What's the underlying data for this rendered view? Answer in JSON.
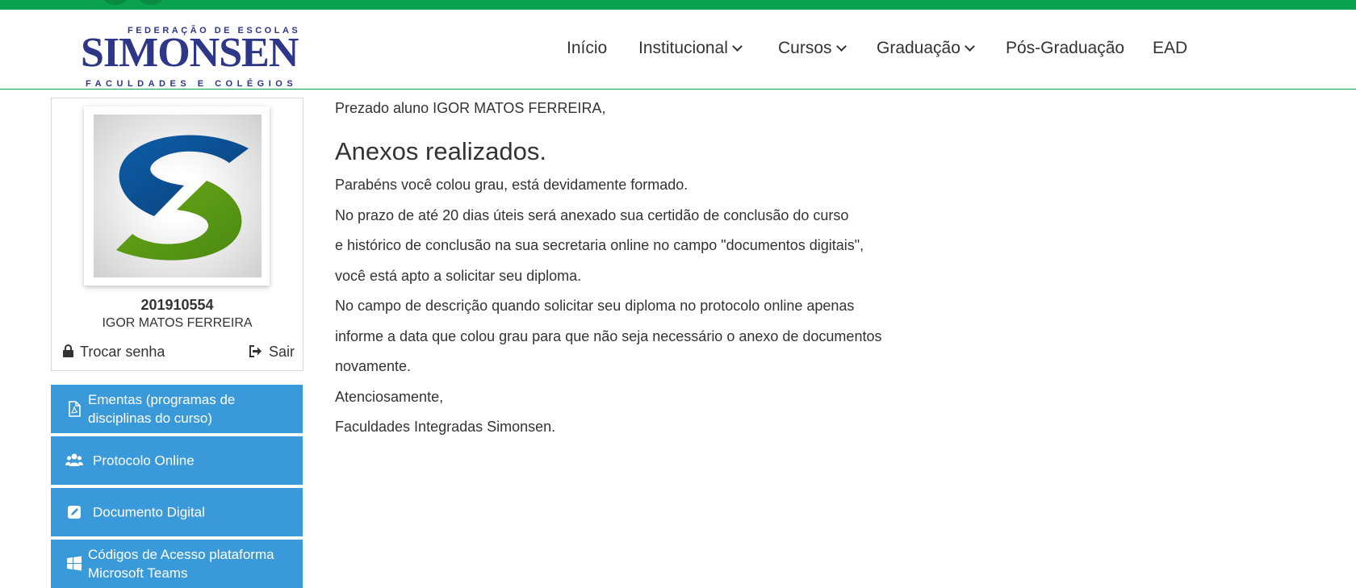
{
  "brand": {
    "top_line": "FEDERAÇÃO DE ESCOLAS",
    "name": "SIMONSEN",
    "bottom_line": "FACULDADES E COLÉGIOS",
    "colors": {
      "green": "#0aa14f",
      "navy": "#2e3687",
      "blue_button": "#3a9ad9"
    }
  },
  "nav": {
    "items": [
      {
        "label": "Início",
        "has_dropdown": false
      },
      {
        "label": "Institucional",
        "has_dropdown": true
      },
      {
        "label": "Cursos",
        "has_dropdown": true
      },
      {
        "label": "Graduação",
        "has_dropdown": true
      },
      {
        "label": "Pós-Graduação",
        "has_dropdown": false
      },
      {
        "label": "EAD",
        "has_dropdown": false
      }
    ]
  },
  "profile": {
    "student_id": "201910554",
    "student_name": "IGOR MATOS FERREIRA",
    "change_password_label": "Trocar senha",
    "logout_label": "Sair"
  },
  "sidebar": {
    "buttons": [
      {
        "label": "Ementas (programas de disciplinas do curso)",
        "icon": "pdf-file-icon"
      },
      {
        "label": "Protocolo Online",
        "icon": "users-icon"
      },
      {
        "label": "Documento Digital",
        "icon": "edit-icon"
      },
      {
        "label": "Códigos de Acesso plataforma Microsoft Teams",
        "icon": "windows-icon"
      }
    ]
  },
  "main": {
    "greeting": "Prezado aluno IGOR MATOS FERREIRA,",
    "title": "Anexos realizados.",
    "paragraphs": [
      "Parabéns você colou grau, está devidamente formado.",
      "No prazo de até 20 dias úteis será anexado sua certidão de conclusão do curso",
      "e histórico de conclusão na sua secretaria online no campo \"documentos digitais\",",
      "você está apto a solicitar seu diploma.",
      "No campo de descrição quando solicitar seu diploma no protocolo online apenas",
      "informe a data que colou grau para que não seja necessário o anexo de documentos",
      "novamente.",
      "Atenciosamente,",
      "Faculdades Integradas Simonsen."
    ]
  }
}
